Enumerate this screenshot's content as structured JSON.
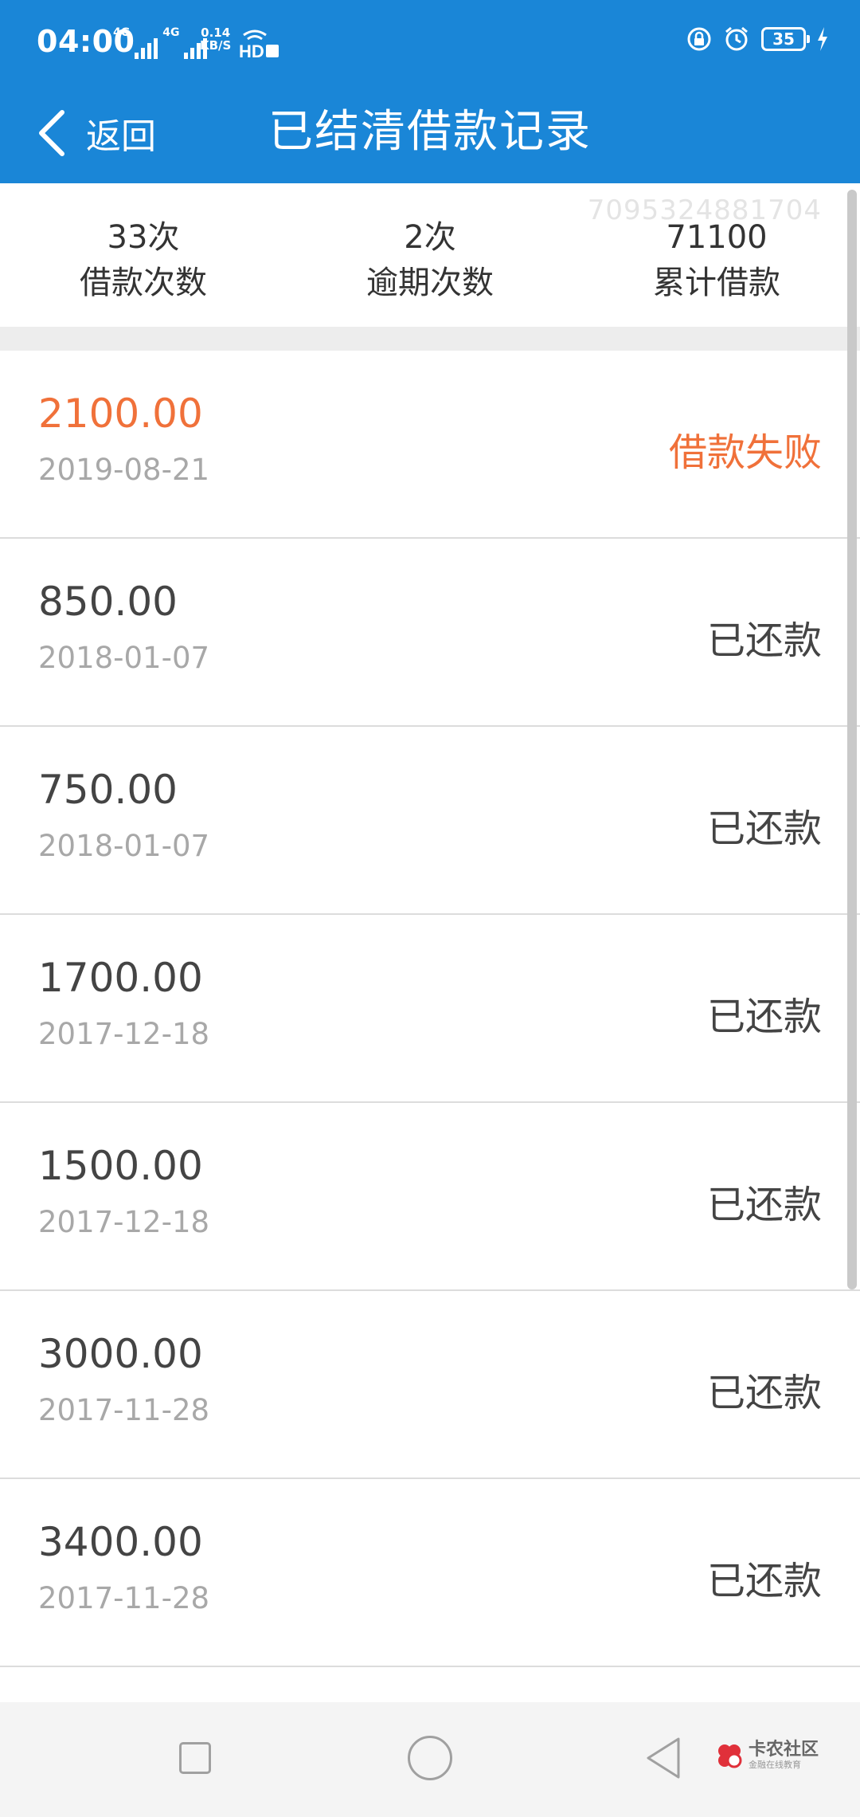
{
  "status_bar": {
    "time": "04:00",
    "net_speed_value": "0.14",
    "net_speed_unit": "KB/S",
    "signal_1_tech": "4G",
    "signal_2_tech": "4G",
    "hd_label": "HD",
    "battery": "35"
  },
  "header": {
    "back_label": "返回",
    "title": "已结清借款记录"
  },
  "summary": {
    "id_number": "7095324881704",
    "stats": [
      {
        "value": "33次",
        "label": "借款次数"
      },
      {
        "value": "2次",
        "label": "逾期次数"
      },
      {
        "value": "71100",
        "label": "累计借款"
      }
    ]
  },
  "records": [
    {
      "amount": "2100.00",
      "date": "2019-08-21",
      "status": "借款失败"
    },
    {
      "amount": "850.00",
      "date": "2018-01-07",
      "status": "已还款"
    },
    {
      "amount": "750.00",
      "date": "2018-01-07",
      "status": "已还款"
    },
    {
      "amount": "1700.00",
      "date": "2017-12-18",
      "status": "已还款"
    },
    {
      "amount": "1500.00",
      "date": "2017-12-18",
      "status": "已还款"
    },
    {
      "amount": "3000.00",
      "date": "2017-11-28",
      "status": "已还款"
    },
    {
      "amount": "3400.00",
      "date": "2017-11-28",
      "status": "已还款"
    }
  ],
  "watermark": {
    "name": "卡农社区",
    "subtitle": "金融在线教育"
  },
  "colors": {
    "header_bg": "#1a86d7",
    "failed_status": "#f0713a",
    "normal_text": "#444444",
    "date_text": "#a8a8a8"
  },
  "icons": [
    "back-chevron-icon",
    "signal-icon",
    "hd-icon",
    "lock-icon",
    "alarm-icon",
    "battery-icon",
    "charging-icon",
    "recent-apps-icon",
    "home-icon",
    "back-nav-icon",
    "watermark-logo-icon"
  ]
}
